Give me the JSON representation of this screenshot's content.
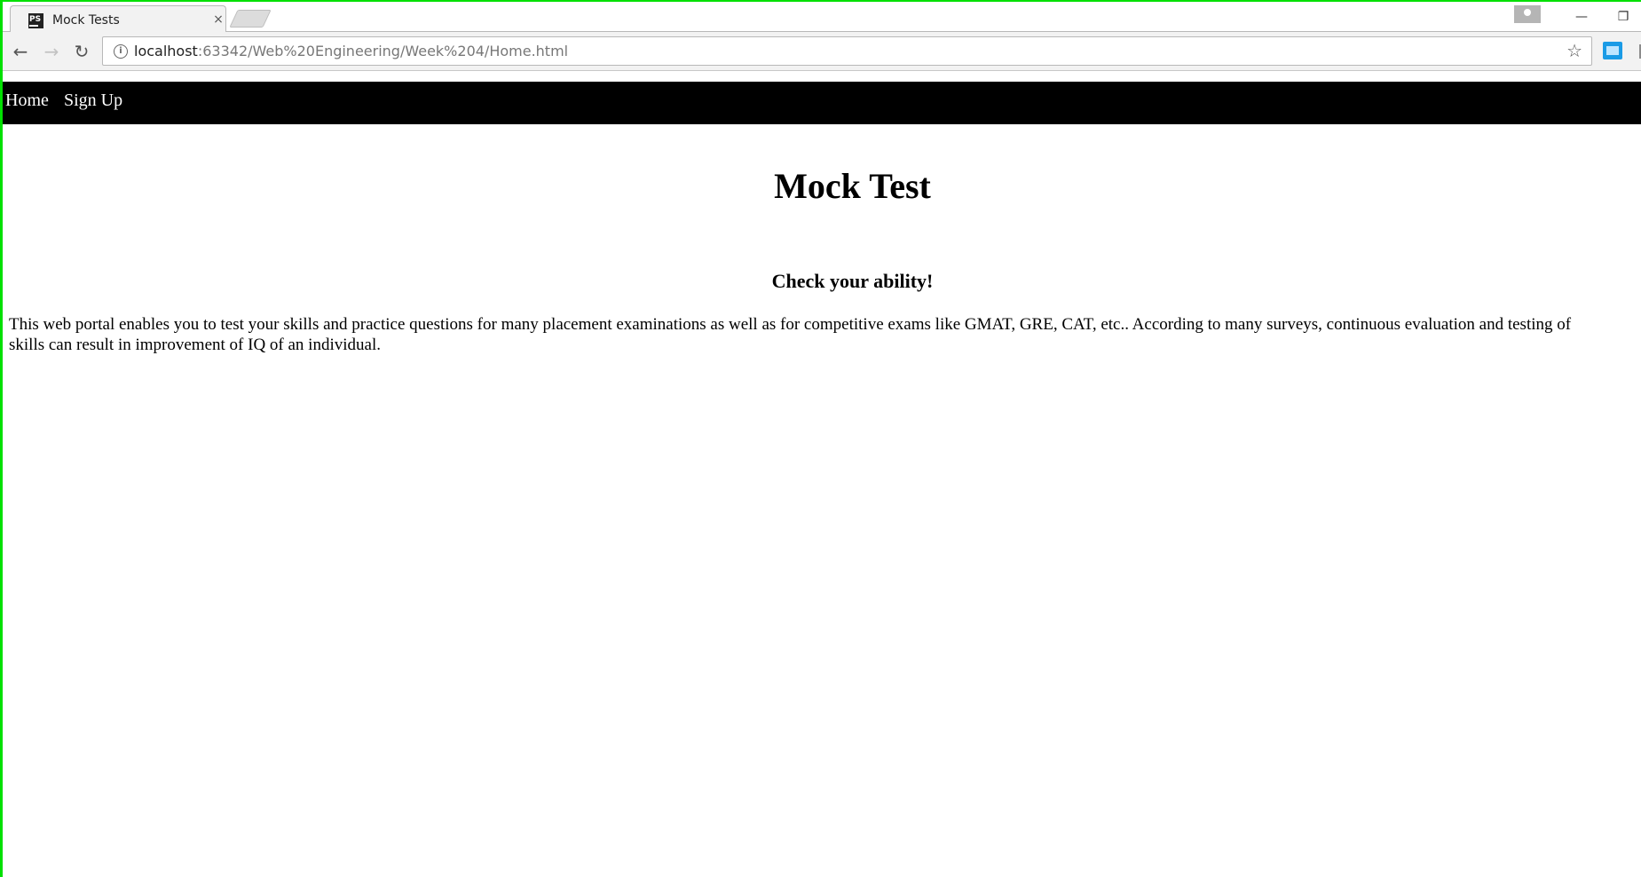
{
  "browser": {
    "tab": {
      "favicon_text": "PS",
      "title": "Mock Tests",
      "close_glyph": "×"
    },
    "window_controls": {
      "minimize_glyph": "—",
      "restore_glyph": "❐"
    },
    "toolbar": {
      "back_glyph": "←",
      "forward_glyph": "→",
      "reload_glyph": "↻",
      "info_glyph": "i",
      "url_host": "localhost",
      "url_path": ":63342/Web%20Engineering/Week%204/Home.html",
      "star_glyph": "☆"
    },
    "icons": {
      "profile": "profile-icon",
      "extension": "extension-icon"
    }
  },
  "page": {
    "nav": {
      "home_label": "Home",
      "signup_label": "Sign Up"
    },
    "title": "Mock Test",
    "subtitle": "Check your ability!",
    "paragraph_line1": "This web portal enables you to test your skills and practice questions for many placement examinations as well as for competitive exams like GMAT, GRE, CAT, etc.. According to many surveys, continuous evaluation and testing of",
    "paragraph_line2": "skills can result in improvement of IQ of an individual."
  },
  "colors": {
    "frame": "#00e000",
    "navbar_bg": "#000000",
    "navbar_text": "#ffffff",
    "extension_accent": "#1a9be6"
  }
}
